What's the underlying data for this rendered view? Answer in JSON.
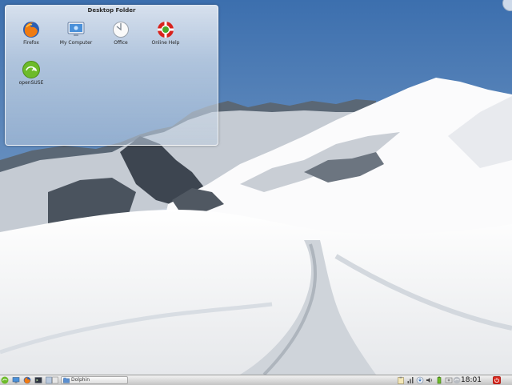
{
  "desktop_folder": {
    "title": "Desktop Folder",
    "icons": [
      {
        "label": "Firefox",
        "icon": "firefox-icon"
      },
      {
        "label": "My Computer",
        "icon": "computer-icon"
      },
      {
        "label": "Office",
        "icon": "office-icon"
      },
      {
        "label": "Online Help",
        "icon": "help-lifebuoy-icon"
      },
      {
        "label": "openSUSE",
        "icon": "opensuse-icon"
      }
    ]
  },
  "taskbar": {
    "launchers": [
      "opensuse-menu-icon",
      "computer-icon",
      "firefox-icon",
      "konsole-icon",
      "pager-icon"
    ],
    "tasks": [
      {
        "label": "Dolphin",
        "icon": "dolphin-icon"
      }
    ],
    "tray": [
      "clipboard-icon",
      "network-icon",
      "updater-icon",
      "volume-icon",
      "battery-icon",
      "device-notifier-icon",
      "opensuse-tray-icon"
    ],
    "clock": "18:01",
    "shutdown_icon": "power-icon"
  },
  "colors": {
    "sky_top": "#3c6fae",
    "sky_bottom": "#b0c6d8",
    "snow": "#f4f5f6",
    "panel": "#d9d9d9",
    "opensuse_green": "#6dbb2a"
  }
}
